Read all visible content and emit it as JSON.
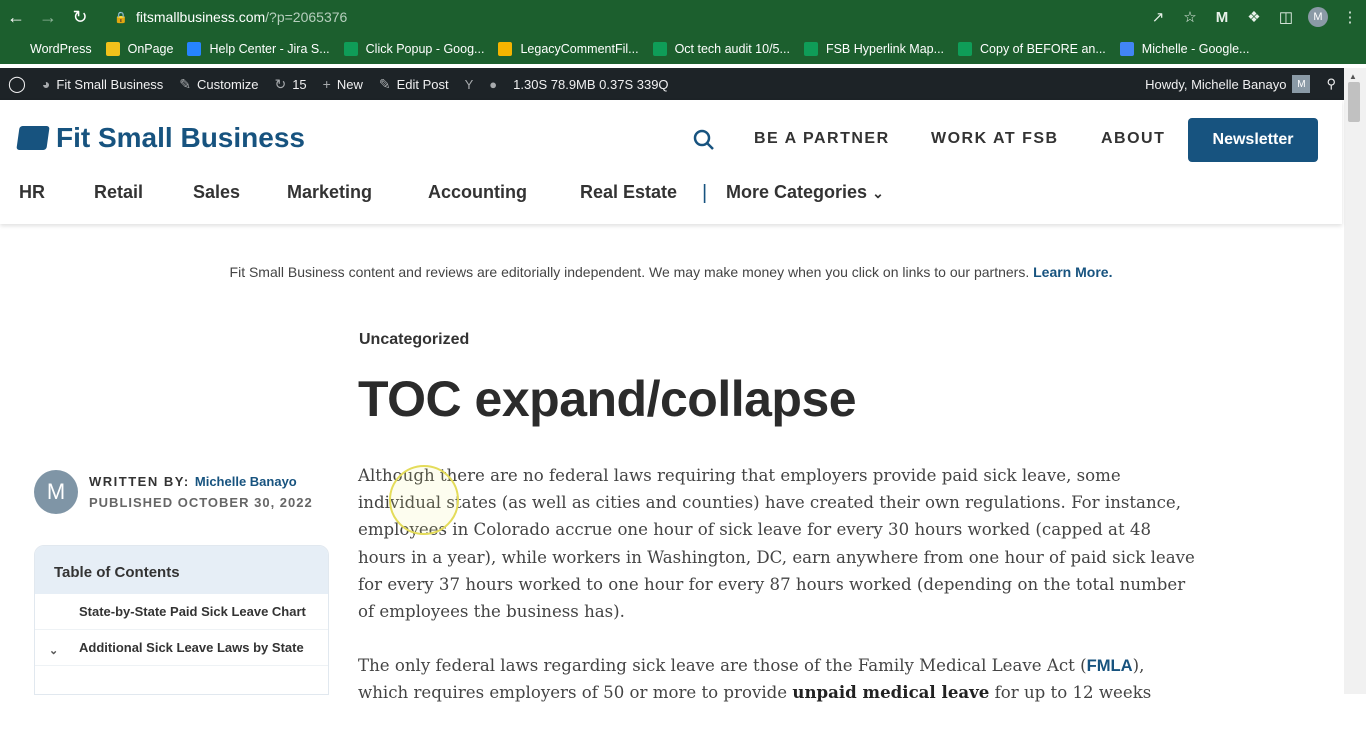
{
  "browser": {
    "url_host": "fitsmallbusiness.com",
    "url_path": "/?p=2065376",
    "profile_initial": "M",
    "bookmarks": [
      {
        "label": "WordPress",
        "color": "#1c5f2e"
      },
      {
        "label": "OnPage",
        "color": "#f2c21b"
      },
      {
        "label": "Help Center - Jira S...",
        "color": "#2684ff"
      },
      {
        "label": "Click Popup - Goog...",
        "color": "#0f9d58"
      },
      {
        "label": "LegacyCommentFil...",
        "color": "#f4b400"
      },
      {
        "label": "Oct tech audit 10/5...",
        "color": "#0f9d58"
      },
      {
        "label": "FSB Hyperlink Map...",
        "color": "#0f9d58"
      },
      {
        "label": "Copy of BEFORE an...",
        "color": "#0f9d58"
      },
      {
        "label": "Michelle - Google...",
        "color": "#4285f4"
      }
    ]
  },
  "wp_admin": {
    "site_name": "Fit Small Business",
    "customize": "Customize",
    "updates_count": "15",
    "new_label": "New",
    "edit_post": "Edit Post",
    "perf_stats": "1.30S  78.9MB  0.37S  339Q",
    "howdy": "Howdy, Michelle Banayo",
    "howdy_initial": "M"
  },
  "header": {
    "logo": "Fit Small Business",
    "top_links": [
      "BE A PARTNER",
      "WORK AT FSB",
      "ABOUT"
    ],
    "newsletter": "Newsletter",
    "categories": [
      "HR",
      "Retail",
      "Sales",
      "Marketing",
      "Accounting",
      "Real Estate"
    ],
    "separator": "|",
    "more_categories": "More Categories"
  },
  "disclosure": {
    "text": "Fit Small Business content and reviews are editorially independent. We may make money when you click on links to our partners.",
    "link": "Learn More."
  },
  "article": {
    "category": "Uncategorized",
    "title": "TOC expand/collapse",
    "author_initial": "M",
    "written_by": "WRITTEN BY:",
    "author": "Michelle Banayo",
    "published": "PUBLISHED OCTOBER 30, 2022",
    "p1": "Although there are no federal laws requiring that employers provide paid sick leave, some individual states (as well as cities and counties) have created their own regulations. For instance, employees in Colorado accrue one hour of sick leave for every 30 hours worked (capped at 48 hours in a year), while workers in Washington, DC, earn anywhere from one hour of paid sick leave for every 37 hours worked to one hour for every 87 hours worked (depending on the total number of employees the business has).",
    "p2_a": "The only federal laws regarding sick leave are those of the Family Medical Leave Act (",
    "p2_link": "FMLA",
    "p2_b": "), which requires employers of 50 or more to provide ",
    "p2_bold": "unpaid medical leave",
    "p2_c": " for up to 12 weeks"
  },
  "toc": {
    "heading": "Table of Contents",
    "items": [
      "State-by-State Paid Sick Leave Chart",
      "Additional Sick Leave Laws by State"
    ]
  }
}
